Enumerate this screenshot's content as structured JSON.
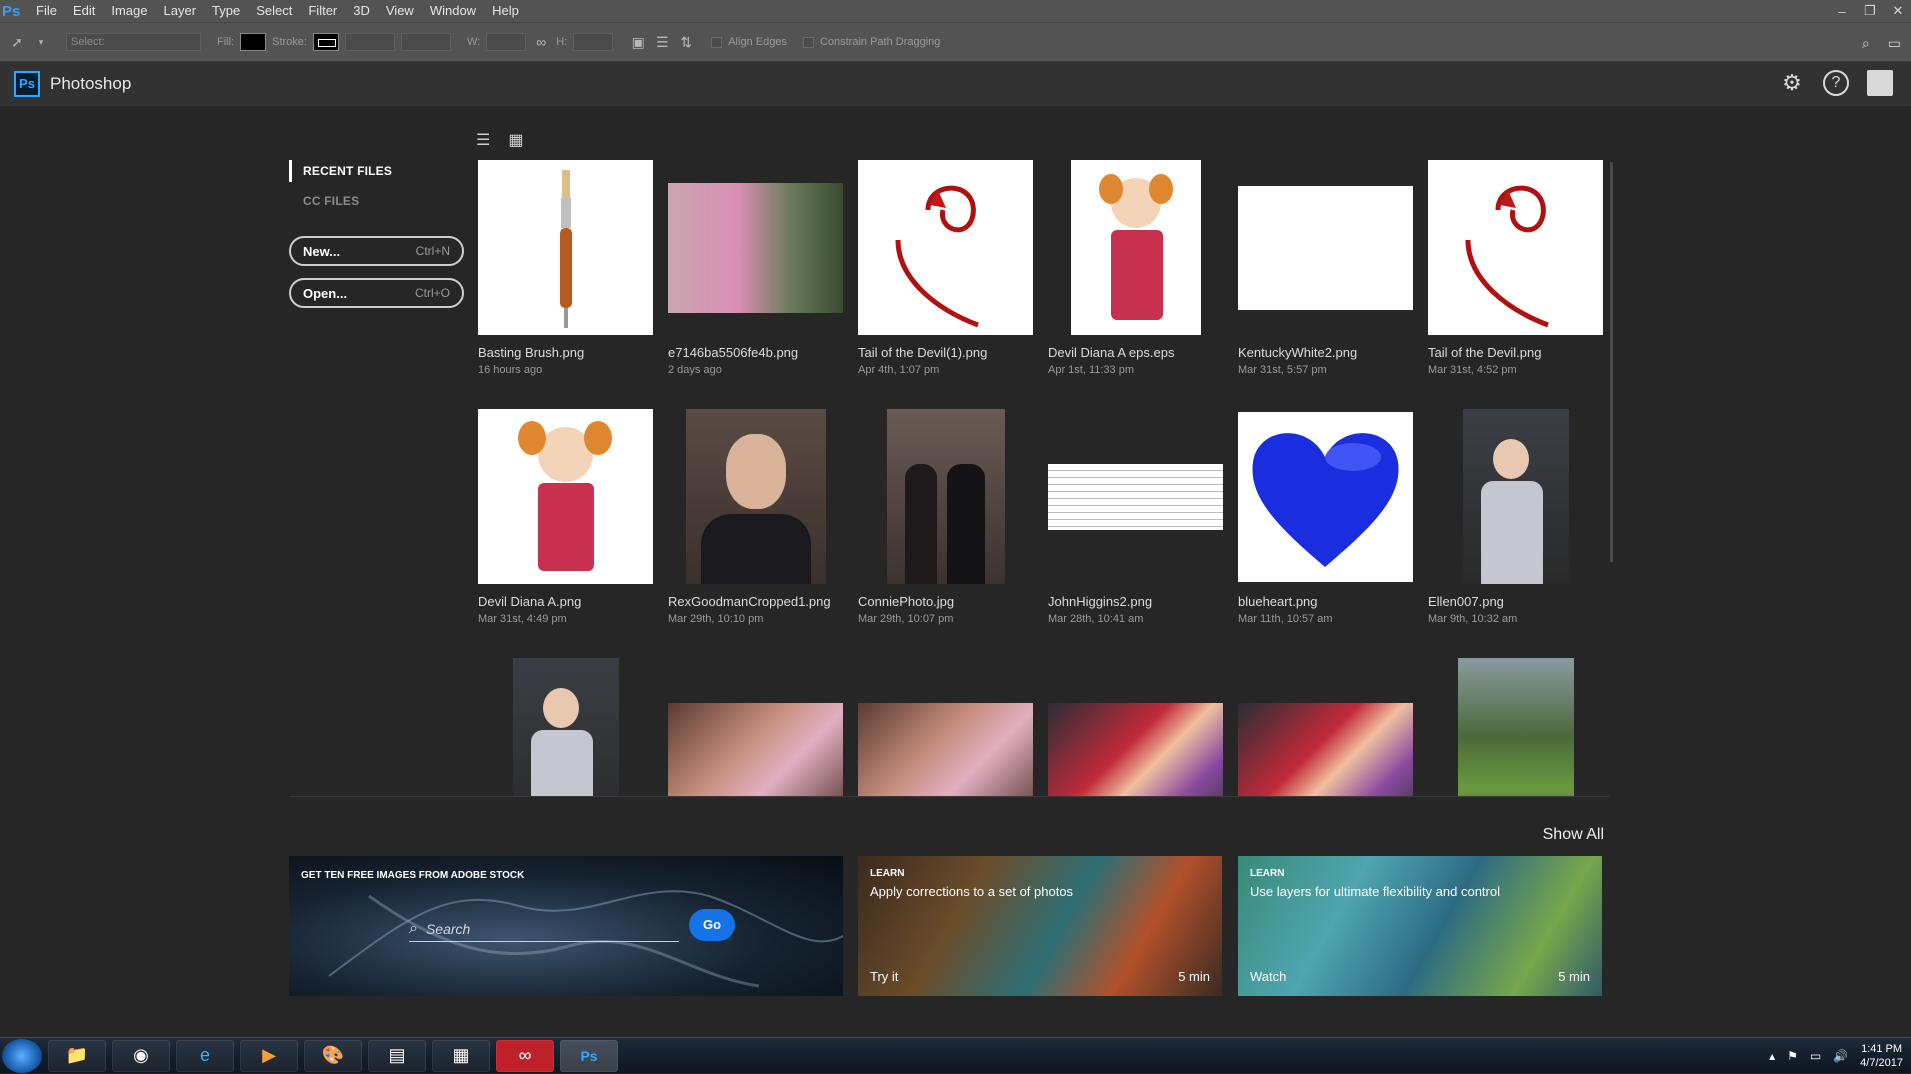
{
  "menubar": {
    "logo": "Ps",
    "items": [
      "File",
      "Edit",
      "Image",
      "Layer",
      "Type",
      "Select",
      "Filter",
      "3D",
      "View",
      "Window",
      "Help"
    ],
    "win_controls": [
      "–",
      "❐",
      "✕"
    ]
  },
  "options": {
    "select_label": "Select:",
    "fill_label": "Fill:",
    "stroke_label": "Stroke:",
    "w_label": "W:",
    "h_label": "H:",
    "align_edges": "Align Edges",
    "constrain": "Constrain Path Dragging"
  },
  "header": {
    "badge": "Ps",
    "title": "Photoshop"
  },
  "nav": {
    "recent": "RECENT FILES",
    "cc": "CC FILES",
    "new_label": "New...",
    "new_shortcut": "Ctrl+N",
    "open_label": "Open...",
    "open_shortcut": "Ctrl+O"
  },
  "files": [
    {
      "name": "Basting Brush.png",
      "date": "16 hours ago"
    },
    {
      "name": "e7146ba5506fe4b.png",
      "date": "2 days ago"
    },
    {
      "name": "Tail of the Devil(1).png",
      "date": "Apr 4th, 1:07 pm"
    },
    {
      "name": "Devil Diana A eps.eps",
      "date": "Apr 1st, 11:33 pm"
    },
    {
      "name": "KentuckyWhite2.png",
      "date": "Mar 31st, 5:57 pm"
    },
    {
      "name": "Tail of the Devil.png",
      "date": "Mar 31st, 4:52 pm"
    },
    {
      "name": "Devil Diana A.png",
      "date": "Mar 31st, 4:49 pm"
    },
    {
      "name": "RexGoodmanCropped1.png",
      "date": "Mar 29th, 10:10 pm"
    },
    {
      "name": "ConniePhoto.jpg",
      "date": "Mar 29th, 10:07 pm"
    },
    {
      "name": "JohnHiggins2.png",
      "date": "Mar 28th, 10:41 am"
    },
    {
      "name": "blueheart.png",
      "date": "Mar 11th, 10:57 am"
    },
    {
      "name": "Ellen007.png",
      "date": "Mar 9th, 10:32 am"
    }
  ],
  "show_all": "Show All",
  "stock": {
    "label": "GET TEN FREE IMAGES FROM ADOBE STOCK",
    "placeholder": "Search",
    "go": "Go"
  },
  "learn1": {
    "tag": "LEARN",
    "title": "Apply corrections to a set of photos",
    "action": "Try it",
    "duration": "5 min"
  },
  "learn2": {
    "tag": "LEARN",
    "title": "Use layers for ultimate flexibility and control",
    "action": "Watch",
    "duration": "5 min"
  },
  "taskbar": {
    "time": "1:41 PM",
    "date": "4/7/2017"
  },
  "colors": {
    "accent": "#1473e6",
    "ps_blue": "#31a8ff"
  }
}
